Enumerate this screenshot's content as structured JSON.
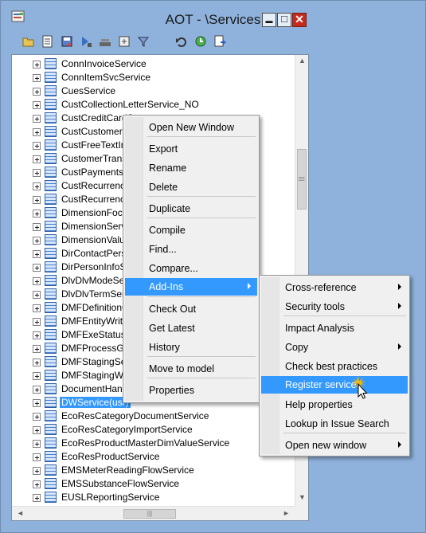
{
  "window": {
    "title": "AOT - \\Services",
    "minimize": "▬",
    "maximize": "□",
    "close": "✕"
  },
  "toolbar": {
    "icons": [
      "open-icon",
      "properties-icon",
      "save-icon",
      "import-icon",
      "compile-icon",
      "refresh-icon",
      "filter-icon",
      "undo-icon",
      "restore-icon",
      "register-icon"
    ]
  },
  "tree": {
    "items": [
      "ConnInvoiceService",
      "ConnItemSvcService",
      "CuesService",
      "CustCollectionLetterService_NO",
      "CustCreditCardServ",
      "CustCustomerServi",
      "CustFreeTextInvoi",
      "CustomerTransfer",
      "CustPaymentsServ",
      "CustRecurrenceIn",
      "CustRecurrenceIn",
      "DimensionFocusS",
      "DimensionServic",
      "DimensionValueS",
      "DirContactPerson",
      "DirPersonInfoSer",
      "DlvDlvModeServi",
      "DlvDlvTermServi",
      "DMFDefinitionGro",
      "DMFEntityWriter",
      "DMFExeStatus",
      "DMFProcessGroup",
      "DMFStagingServi",
      "DMFStagingWrite",
      "DocumentHandli",
      "DWService(usr)",
      "EcoResCategoryDocumentService",
      "EcoResCategoryImportService",
      "EcoResProductMasterDimValueService",
      "EcoResProductService",
      "EMSMeterReadingFlowService",
      "EMSSubstanceFlowService",
      "EUSLReportingService"
    ],
    "selected_index": 25
  },
  "context_menu": {
    "items": [
      {
        "label": "Open New Window"
      },
      {
        "label": "Export"
      },
      {
        "label": "Rename"
      },
      {
        "label": "Delete"
      },
      {
        "label": "Duplicate"
      },
      {
        "label": "Compile"
      },
      {
        "label": "Find..."
      },
      {
        "label": "Compare..."
      },
      {
        "label": "Add-Ins",
        "submenu": true,
        "highlighted": true
      },
      {
        "label": "Check Out"
      },
      {
        "label": "Get Latest"
      },
      {
        "label": "History"
      },
      {
        "label": "Move to model"
      },
      {
        "label": "Properties"
      }
    ]
  },
  "submenu": {
    "items": [
      {
        "label": "Cross-reference",
        "submenu": true
      },
      {
        "label": "Security tools",
        "submenu": true
      },
      {
        "label": "Impact Analysis"
      },
      {
        "label": "Copy",
        "submenu": true
      },
      {
        "label": "Check best practices"
      },
      {
        "label": "Register service",
        "highlighted": true
      },
      {
        "label": "Help properties"
      },
      {
        "label": "Lookup in Issue Search"
      },
      {
        "label": "Open new window",
        "submenu": true
      }
    ]
  },
  "scrollbars": {
    "up": "▲",
    "down": "▼",
    "left": "◄",
    "right": "►",
    "grip": "|||"
  },
  "colors": {
    "frame": "#8fb2dc",
    "highlight": "#3399ff",
    "close": "#c42b1c"
  }
}
